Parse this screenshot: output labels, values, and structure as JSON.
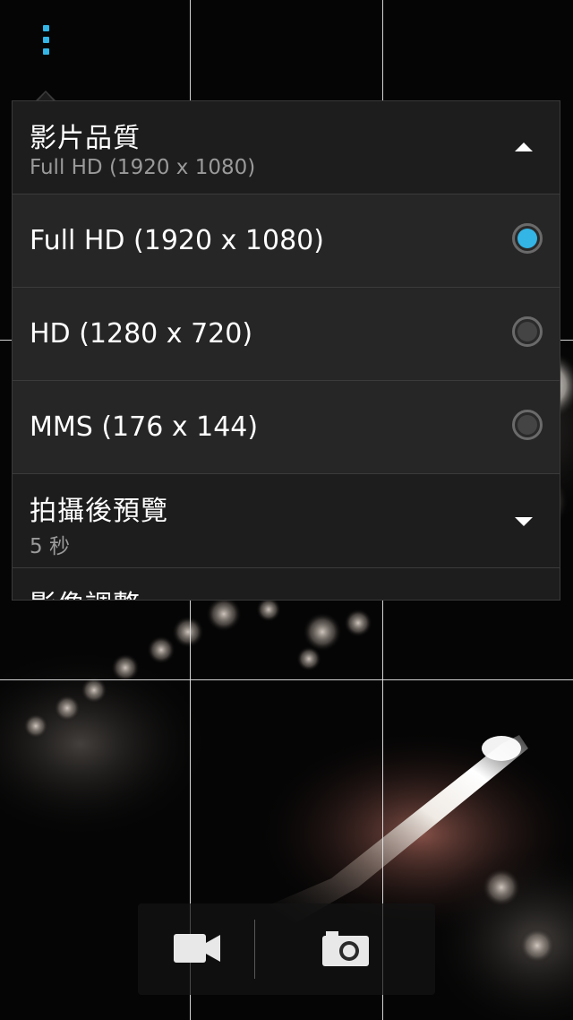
{
  "menu": {
    "icon": "overflow-menu-icon",
    "accent_color": "#33b5e5"
  },
  "settings": {
    "video_quality": {
      "title": "影片品質",
      "current_value": "Full HD (1920 x 1080)",
      "expanded": true,
      "options": [
        {
          "label": "Full HD (1920 x 1080)",
          "selected": true
        },
        {
          "label": "HD (1280 x 720)",
          "selected": false
        },
        {
          "label": "MMS (176 x 144)",
          "selected": false
        }
      ]
    },
    "review_duration": {
      "title": "拍攝後預覽",
      "current_value": "5 秒",
      "expanded": false
    },
    "image_adjustments": {
      "title": "影像調整"
    }
  },
  "capture_bar": {
    "video_icon": "video-camera-icon",
    "photo_icon": "camera-icon"
  },
  "colors": {
    "selected_radio": "#33b5e5",
    "panel_background": "#1c1c1c"
  }
}
